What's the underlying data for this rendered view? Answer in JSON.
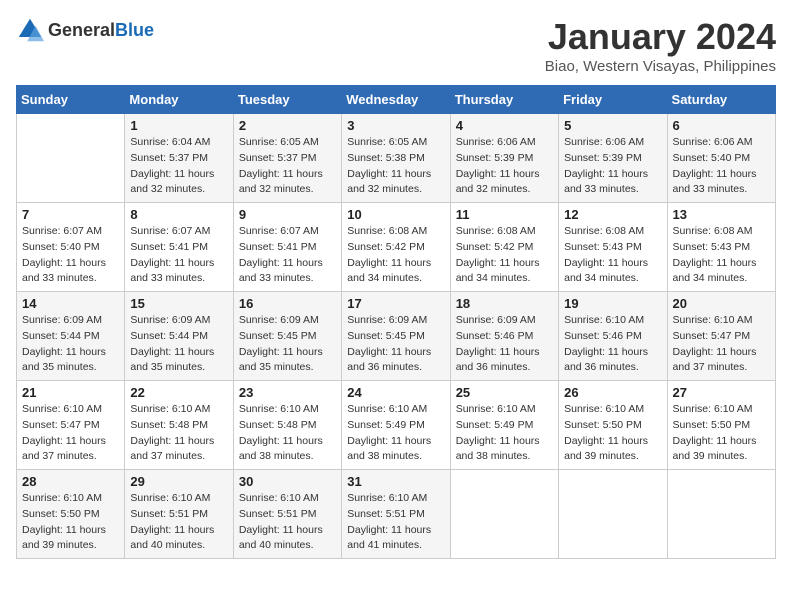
{
  "header": {
    "logo_general": "General",
    "logo_blue": "Blue",
    "month_title": "January 2024",
    "location": "Biao, Western Visayas, Philippines"
  },
  "weekdays": [
    "Sunday",
    "Monday",
    "Tuesday",
    "Wednesday",
    "Thursday",
    "Friday",
    "Saturday"
  ],
  "weeks": [
    [
      {
        "day": "",
        "info": ""
      },
      {
        "day": "1",
        "info": "Sunrise: 6:04 AM\nSunset: 5:37 PM\nDaylight: 11 hours\nand 32 minutes."
      },
      {
        "day": "2",
        "info": "Sunrise: 6:05 AM\nSunset: 5:37 PM\nDaylight: 11 hours\nand 32 minutes."
      },
      {
        "day": "3",
        "info": "Sunrise: 6:05 AM\nSunset: 5:38 PM\nDaylight: 11 hours\nand 32 minutes."
      },
      {
        "day": "4",
        "info": "Sunrise: 6:06 AM\nSunset: 5:39 PM\nDaylight: 11 hours\nand 32 minutes."
      },
      {
        "day": "5",
        "info": "Sunrise: 6:06 AM\nSunset: 5:39 PM\nDaylight: 11 hours\nand 33 minutes."
      },
      {
        "day": "6",
        "info": "Sunrise: 6:06 AM\nSunset: 5:40 PM\nDaylight: 11 hours\nand 33 minutes."
      }
    ],
    [
      {
        "day": "7",
        "info": "Sunrise: 6:07 AM\nSunset: 5:40 PM\nDaylight: 11 hours\nand 33 minutes."
      },
      {
        "day": "8",
        "info": "Sunrise: 6:07 AM\nSunset: 5:41 PM\nDaylight: 11 hours\nand 33 minutes."
      },
      {
        "day": "9",
        "info": "Sunrise: 6:07 AM\nSunset: 5:41 PM\nDaylight: 11 hours\nand 33 minutes."
      },
      {
        "day": "10",
        "info": "Sunrise: 6:08 AM\nSunset: 5:42 PM\nDaylight: 11 hours\nand 34 minutes."
      },
      {
        "day": "11",
        "info": "Sunrise: 6:08 AM\nSunset: 5:42 PM\nDaylight: 11 hours\nand 34 minutes."
      },
      {
        "day": "12",
        "info": "Sunrise: 6:08 AM\nSunset: 5:43 PM\nDaylight: 11 hours\nand 34 minutes."
      },
      {
        "day": "13",
        "info": "Sunrise: 6:08 AM\nSunset: 5:43 PM\nDaylight: 11 hours\nand 34 minutes."
      }
    ],
    [
      {
        "day": "14",
        "info": "Sunrise: 6:09 AM\nSunset: 5:44 PM\nDaylight: 11 hours\nand 35 minutes."
      },
      {
        "day": "15",
        "info": "Sunrise: 6:09 AM\nSunset: 5:44 PM\nDaylight: 11 hours\nand 35 minutes."
      },
      {
        "day": "16",
        "info": "Sunrise: 6:09 AM\nSunset: 5:45 PM\nDaylight: 11 hours\nand 35 minutes."
      },
      {
        "day": "17",
        "info": "Sunrise: 6:09 AM\nSunset: 5:45 PM\nDaylight: 11 hours\nand 36 minutes."
      },
      {
        "day": "18",
        "info": "Sunrise: 6:09 AM\nSunset: 5:46 PM\nDaylight: 11 hours\nand 36 minutes."
      },
      {
        "day": "19",
        "info": "Sunrise: 6:10 AM\nSunset: 5:46 PM\nDaylight: 11 hours\nand 36 minutes."
      },
      {
        "day": "20",
        "info": "Sunrise: 6:10 AM\nSunset: 5:47 PM\nDaylight: 11 hours\nand 37 minutes."
      }
    ],
    [
      {
        "day": "21",
        "info": "Sunrise: 6:10 AM\nSunset: 5:47 PM\nDaylight: 11 hours\nand 37 minutes."
      },
      {
        "day": "22",
        "info": "Sunrise: 6:10 AM\nSunset: 5:48 PM\nDaylight: 11 hours\nand 37 minutes."
      },
      {
        "day": "23",
        "info": "Sunrise: 6:10 AM\nSunset: 5:48 PM\nDaylight: 11 hours\nand 38 minutes."
      },
      {
        "day": "24",
        "info": "Sunrise: 6:10 AM\nSunset: 5:49 PM\nDaylight: 11 hours\nand 38 minutes."
      },
      {
        "day": "25",
        "info": "Sunrise: 6:10 AM\nSunset: 5:49 PM\nDaylight: 11 hours\nand 38 minutes."
      },
      {
        "day": "26",
        "info": "Sunrise: 6:10 AM\nSunset: 5:50 PM\nDaylight: 11 hours\nand 39 minutes."
      },
      {
        "day": "27",
        "info": "Sunrise: 6:10 AM\nSunset: 5:50 PM\nDaylight: 11 hours\nand 39 minutes."
      }
    ],
    [
      {
        "day": "28",
        "info": "Sunrise: 6:10 AM\nSunset: 5:50 PM\nDaylight: 11 hours\nand 39 minutes."
      },
      {
        "day": "29",
        "info": "Sunrise: 6:10 AM\nSunset: 5:51 PM\nDaylight: 11 hours\nand 40 minutes."
      },
      {
        "day": "30",
        "info": "Sunrise: 6:10 AM\nSunset: 5:51 PM\nDaylight: 11 hours\nand 40 minutes."
      },
      {
        "day": "31",
        "info": "Sunrise: 6:10 AM\nSunset: 5:51 PM\nDaylight: 11 hours\nand 41 minutes."
      },
      {
        "day": "",
        "info": ""
      },
      {
        "day": "",
        "info": ""
      },
      {
        "day": "",
        "info": ""
      }
    ]
  ]
}
